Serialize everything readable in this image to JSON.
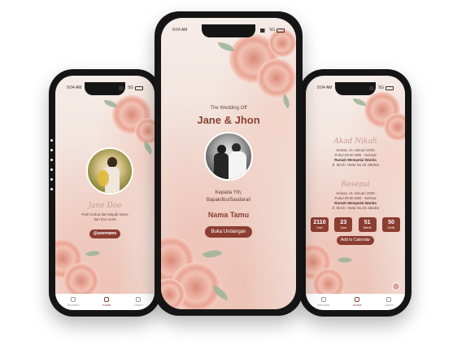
{
  "status": {
    "time": "9:04 AM",
    "network": "5G"
  },
  "left": {
    "name": "Jane Doe",
    "subtitle": "Putri Kedua dari Bapak Steve dan Ibu Laura",
    "handle_button": "@username",
    "nav": [
      "Beranda",
      "Kisah",
      "Galeri"
    ]
  },
  "center": {
    "kicker": "The Wedding Off",
    "couple": "Jane & Jhon",
    "greeting_line1": "Kepada Yth,",
    "greeting_line2": "Bapak/Ibu/Saudara/i",
    "guest_name": "Nama Tamu",
    "open_button": "Buka Undangan"
  },
  "right": {
    "akad": {
      "title": "Akad Nikah",
      "date": "Selasa, 31 Januari 2030",
      "time": "Pukul 09.00 WIB - Selesai",
      "place": "Rumah Mempelai Wanita",
      "address": "Jl. Moch. Hatta No.26 Jakarta"
    },
    "resepsi": {
      "title": "Resepsi",
      "date": "Selasa, 31 Januari 2030",
      "time": "Pukul 09.00 WIB - Selesai",
      "place": "Rumah Mempelai Wanita",
      "address": "Jl. Moch. Hatta No.26 Jakarta"
    },
    "countdown": [
      {
        "value": "2110",
        "unit": "Hari"
      },
      {
        "value": "23",
        "unit": "Jam"
      },
      {
        "value": "51",
        "unit": "Menit"
      },
      {
        "value": "50",
        "unit": "Detik"
      }
    ],
    "calendar_button": "Add to Calendar",
    "nav": [
      "Beranda",
      "Acara",
      "Galeri"
    ]
  },
  "colors": {
    "accent": "#8c3d31",
    "blush": "#f2ddd5",
    "rose": "#e8a898",
    "leaf": "#9fb59a"
  }
}
